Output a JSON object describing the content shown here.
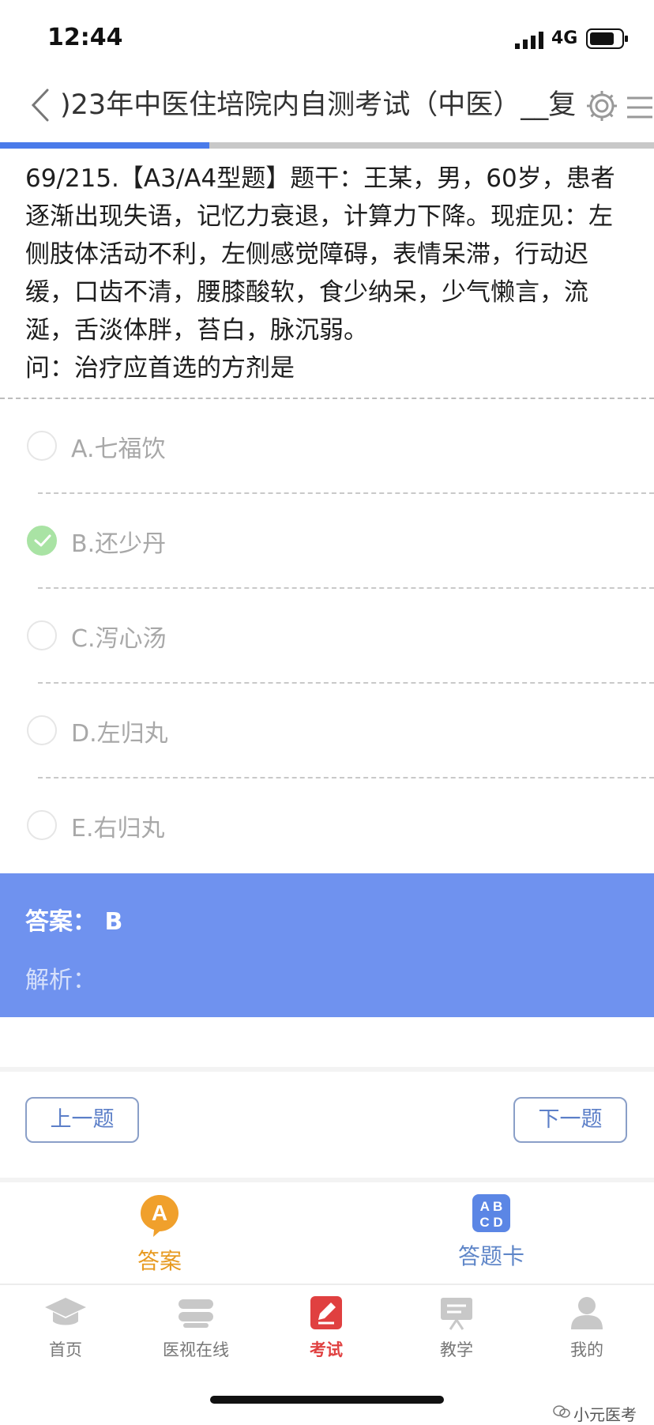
{
  "status_bar": {
    "time": "12:44",
    "network": "4G"
  },
  "nav": {
    "title": ")23年中医住培院内自测考试（中医）__复"
  },
  "progress": {
    "current": 69,
    "total": 215,
    "fraction": 0.32
  },
  "question": {
    "line1": "69/215.【A3/A4型题】题干：王某，男，60岁，患者逐渐出现失语，记忆力衰退，计算力下降。现症见：左侧肢体活动不利，左侧感觉障碍，表情呆滞，行动迟缓，口齿不清，腰膝酸软，食少纳呆，少气懒言，流涎，舌淡体胖，苔白，脉沉弱。",
    "line2": "问：治疗应首选的方剂是"
  },
  "options": [
    {
      "label": "A.七福饮",
      "selected": false
    },
    {
      "label": "B.还少丹",
      "selected": true
    },
    {
      "label": "C.泻心汤",
      "selected": false
    },
    {
      "label": "D.左归丸",
      "selected": false
    },
    {
      "label": "E.右归丸",
      "selected": false
    }
  ],
  "answer": {
    "text": "答案： B",
    "analysis_label": "解析："
  },
  "buttons": {
    "prev": "上一题",
    "next": "下一题"
  },
  "tools": {
    "answer": {
      "label": "答案",
      "icon": "A"
    },
    "card": {
      "label": "答题卡",
      "icon_top": "A B",
      "icon_bottom": "C D"
    }
  },
  "tabs": [
    {
      "label": "首页",
      "icon": "graduation-cap-icon"
    },
    {
      "label": "医视在线",
      "icon": "video-stack-icon"
    },
    {
      "label": "考试",
      "icon": "pencil-exam-icon",
      "active": true
    },
    {
      "label": "教学",
      "icon": "presentation-board-icon"
    },
    {
      "label": "我的",
      "icon": "user-icon"
    }
  ],
  "watermark": "小元医考",
  "colors": {
    "accent": "#4a7bea",
    "answer_panel": "#6f92ef",
    "exam_tab": "#e04040",
    "answer_tool": "#e79a21"
  }
}
